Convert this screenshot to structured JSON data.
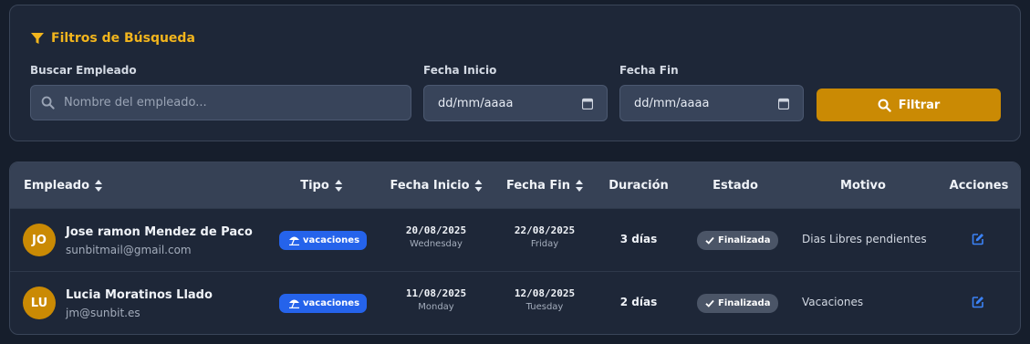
{
  "filters": {
    "title": "Filtros de Búsqueda",
    "search_label": "Buscar Empleado",
    "search_placeholder": "Nombre del empleado...",
    "start_label": "Fecha Inicio",
    "start_value": "dd/mm/aaaa",
    "end_label": "Fecha Fin",
    "end_value": "dd/mm/aaaa",
    "filter_button": "Filtrar",
    "accent_color": "#f2b51d"
  },
  "table": {
    "headers": {
      "empleado": "Empleado",
      "tipo": "Tipo",
      "fecha_inicio": "Fecha Inicio",
      "fecha_fin": "Fecha Fin",
      "duracion": "Duración",
      "estado": "Estado",
      "motivo": "Motivo",
      "acciones": "Acciones"
    },
    "rows": [
      {
        "initials": "JO",
        "name": "Jose ramon Mendez de Paco",
        "email": "sunbitmail@gmail.com",
        "tipo": "vacaciones",
        "start_date": "20/08/2025",
        "start_day": "Wednesday",
        "end_date": "22/08/2025",
        "end_day": "Friday",
        "duration": "3 días",
        "estado": "Finalizada",
        "motivo": "Dias Libres pendientes"
      },
      {
        "initials": "LU",
        "name": "Lucia Moratinos Llado",
        "email": "jm@sunbit.es",
        "tipo": "vacaciones",
        "start_date": "11/08/2025",
        "start_day": "Monday",
        "end_date": "12/08/2025",
        "end_day": "Tuesday",
        "duration": "2 días",
        "estado": "Finalizada",
        "motivo": "Vacaciones"
      }
    ],
    "tipo_color": "#2563eb",
    "avatar_color": "#ca8a04"
  }
}
